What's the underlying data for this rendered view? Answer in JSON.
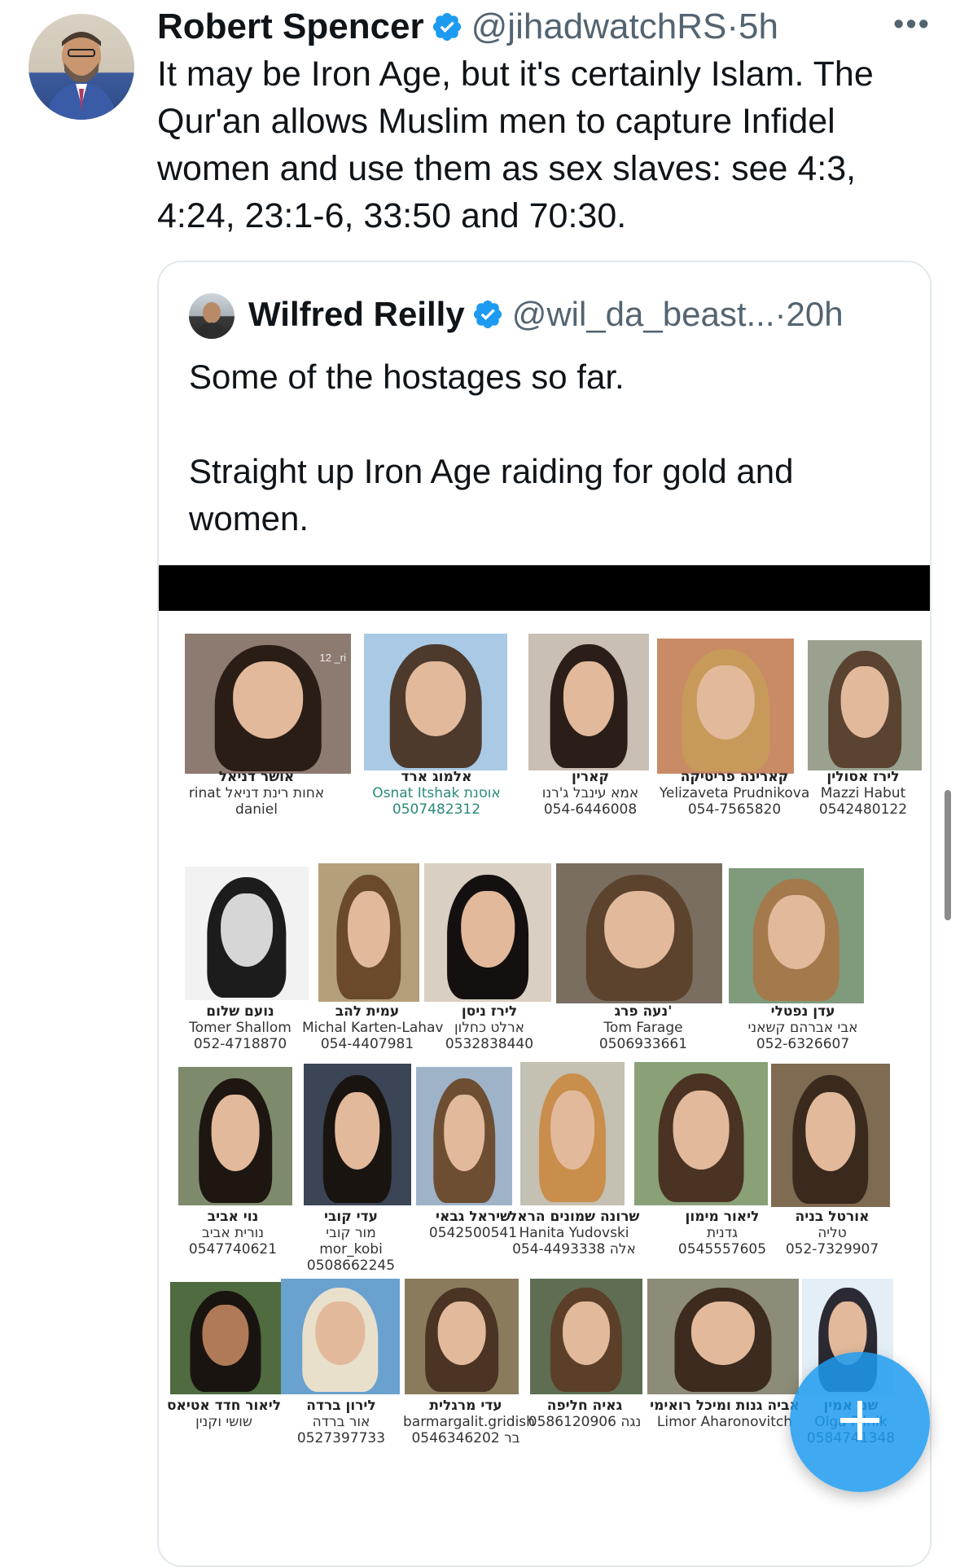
{
  "tweet": {
    "author_name": "Robert Spencer",
    "handle": "@jihadwatchRS",
    "separator": "·",
    "time": "5h",
    "more": "•••",
    "text": "It may be Iron Age, but it's certainly Islam. The Qur'an allows Muslim men to capture Infidel women and use them as sex slaves: see 4:3, 4:24, 23:1-6, 33:50 and 70:30."
  },
  "quoted_tweet": {
    "author_name": "Wilfred Reilly",
    "handle": "@wil_da_beast...",
    "separator": "·",
    "time": "20h",
    "text": "Some of the hostages so far.\n\nStraight up Iron Age raiding for gold and women."
  },
  "media": {
    "watermark": "12 _ri",
    "captions": [
      {
        "lines": [
          "אושר דניאל",
          "rinat אחות רינת דניאל",
          "daniel"
        ]
      },
      {
        "lines": [
          "אלמוג ארד",
          "Osnat Itshak אוסנת",
          "0507482312"
        ]
      },
      {
        "lines": [
          "קארין",
          "אמא עינבל ג'רנו",
          "054-6446008"
        ]
      },
      {
        "lines": [
          "קארינה פריטיקה",
          "Yelizaveta Prudnikova",
          "054-7565820"
        ]
      },
      {
        "lines": [
          "לירז אסולין",
          "Mazzi Habut",
          "0542480122"
        ]
      },
      {
        "lines": [
          "נועם שלום",
          "Tomer Shallom",
          "052-4718870"
        ]
      },
      {
        "lines": [
          "עמית להב",
          "Michal Karten-Lahav",
          "054-4407981"
        ]
      },
      {
        "lines": [
          "לירז ניסן",
          "ארלט כחלון",
          "0532838440"
        ]
      },
      {
        "lines": [
          "נעה פרג'",
          "Tom Farage",
          "0506933661"
        ]
      },
      {
        "lines": [
          "עדן נפטלי",
          "אבי אברהם קשאני",
          "052-6326607"
        ]
      },
      {
        "lines": [
          "נוי אביב",
          "נורית אביב",
          "0547740621"
        ]
      },
      {
        "lines": [
          "עדי קובי",
          "מור קובי",
          "mor_kobi",
          "0508662245"
        ]
      },
      {
        "lines": [
          "שיראל גבאי",
          "0542500541"
        ]
      },
      {
        "lines": [
          "שרונה שמונים הראל",
          "Hanita Yudovski",
          "אלה 054-4493338"
        ]
      },
      {
        "lines": [
          "ליאור מימון",
          "גדנית",
          "0545557605"
        ]
      },
      {
        "lines": [
          "אורטל בניה",
          "טליה",
          "052-7329907"
        ]
      },
      {
        "lines": [
          "ליאור חדד אטיאס",
          "שושי וקנין"
        ]
      },
      {
        "lines": [
          "לירון ברדה",
          "אור ברדה",
          "0527397733"
        ]
      },
      {
        "lines": [
          "עדי מרגלית",
          "barmargalit.gridish",
          "0546346202 בר"
        ]
      },
      {
        "lines": [
          "גאיה חליפה",
          "0586120906 נגה"
        ]
      },
      {
        "lines": [
          "אביה גנות ומיכל רואימי",
          "Limor Aharonovitch"
        ]
      },
      {
        "lines": [
          "שני אמין",
          "Olga Pilnik",
          "0584741348"
        ]
      }
    ]
  },
  "colors": {
    "verified": "#1d9bf0",
    "muted": "#536471",
    "border": "#e1e8ed",
    "compose": "#1d9bf0"
  },
  "icons": {
    "verified": "verified-badge-icon",
    "more": "more-dots-icon",
    "compose": "plus-icon"
  }
}
